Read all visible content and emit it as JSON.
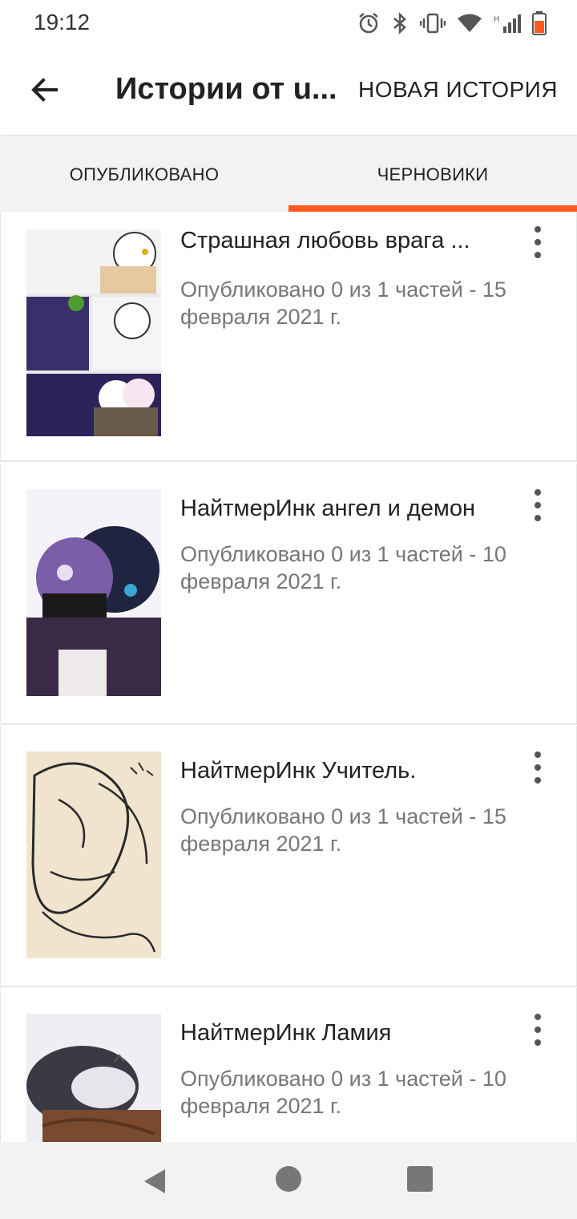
{
  "status_bar": {
    "time": "19:12",
    "icons": [
      "alarm-icon",
      "bluetooth-icon",
      "vibrate-icon",
      "wifi-icon",
      "signal-icon",
      "battery-icon"
    ],
    "signal_label": "H"
  },
  "app_bar": {
    "title": "Истории от u...",
    "action_label": "НОВАЯ ИСТОРИЯ",
    "back_icon": "back-arrow-icon"
  },
  "tabs": [
    {
      "label": "ОПУБЛИКОВАНО",
      "active": false
    },
    {
      "label": "ЧЕРНОВИКИ",
      "active": true
    }
  ],
  "accent_color": "#ff5a1f",
  "stories": [
    {
      "title": "Страшная любовь врага ...",
      "meta": "Опубликовано 0 из 1 частей - 15 февраля 2021 г."
    },
    {
      "title": "НайтмерИнк ангел и демон",
      "meta": "Опубликовано 0 из 1 частей - 10 февраля 2021 г."
    },
    {
      "title": "НайтмерИнк Учитель.",
      "meta": "Опубликовано 0 из 1 частей - 15 февраля 2021 г."
    },
    {
      "title": "НайтмерИнк Ламия",
      "meta": "Опубликовано 0 из 1 частей - 10 февраля 2021 г."
    }
  ],
  "nav_bar": {
    "icons": [
      "nav-back-icon",
      "nav-home-icon",
      "nav-recents-icon"
    ]
  }
}
